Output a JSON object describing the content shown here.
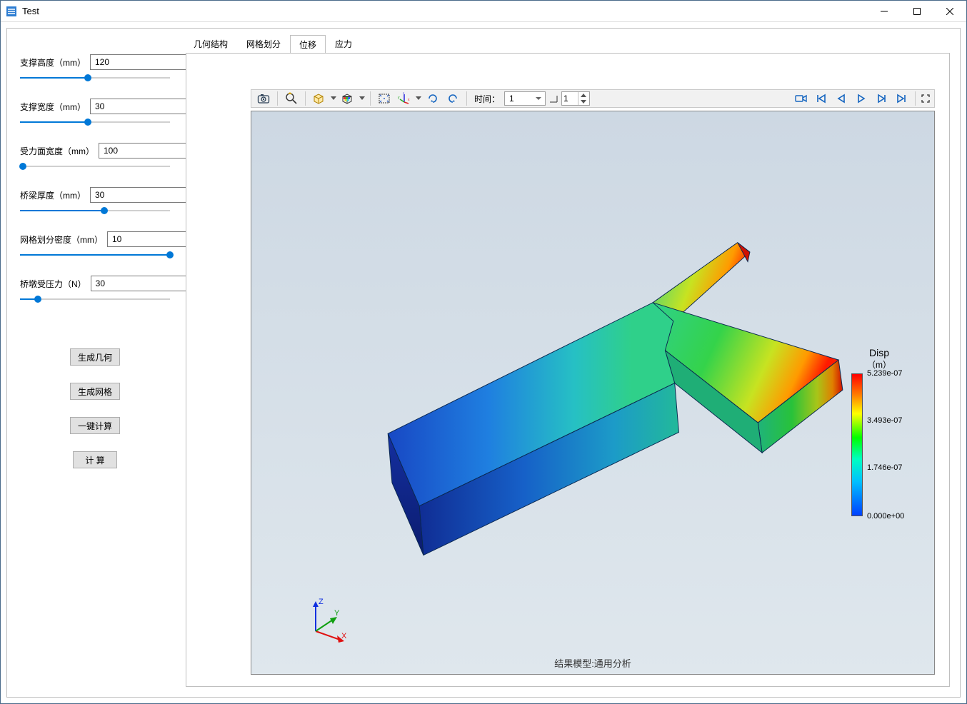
{
  "window": {
    "title": "Test"
  },
  "sidebar": {
    "params": [
      {
        "label": "支撑高度（mm）",
        "value": "120",
        "fill": 45
      },
      {
        "label": "支撑宽度（mm）",
        "value": "30",
        "fill": 45
      },
      {
        "label": "受力面宽度（mm）",
        "value": "100",
        "fill": 2
      },
      {
        "label": "桥梁厚度（mm）",
        "value": "30",
        "fill": 56
      },
      {
        "label": "网格划分密度（mm）",
        "value": "10",
        "fill": 100
      },
      {
        "label": "桥墩受压力（N）",
        "value": "30",
        "fill": 12
      }
    ],
    "buttons": {
      "gen_geom": "生成几何",
      "gen_mesh": "生成网格",
      "one_click": "一键计算",
      "compute": "计 算"
    }
  },
  "tabs": {
    "items": [
      {
        "label": "几何结构"
      },
      {
        "label": "网格划分"
      },
      {
        "label": "位移"
      },
      {
        "label": "应力"
      }
    ],
    "active_index": 2
  },
  "toolbar": {
    "time_label": "时间：",
    "time_value": "1",
    "step_value": "1"
  },
  "viewport": {
    "bottom_label": "结果模型:通用分析",
    "axes": {
      "x": "X",
      "y": "Y",
      "z": "Z"
    }
  },
  "legend": {
    "title": "Disp",
    "unit": "（m）",
    "ticks": [
      {
        "label": "5.239e-07",
        "pos": 0
      },
      {
        "label": "3.493e-07",
        "pos": 33
      },
      {
        "label": "1.746e-07",
        "pos": 66
      },
      {
        "label": "0.000e+00",
        "pos": 100
      }
    ]
  },
  "chart_data": {
    "type": "heatmap",
    "quantity": "Displacement",
    "unit": "m",
    "color_scale": {
      "min": 0.0,
      "max": 5.239e-07,
      "ticks": [
        0.0,
        1.746e-07,
        3.493e-07,
        5.239e-07
      ],
      "colormap": "rainbow"
    },
    "title": "结果模型:通用分析"
  }
}
